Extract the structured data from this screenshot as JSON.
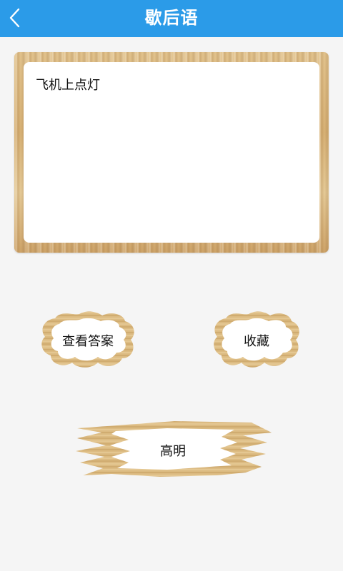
{
  "header": {
    "title": "歇后语",
    "back_icon": "chevron-left-icon"
  },
  "riddle": {
    "question": "飞机上点灯",
    "answer": "高明"
  },
  "buttons": {
    "show_answer": "查看答案",
    "favorite": "收藏"
  },
  "colors": {
    "header_bg": "#2b9be8",
    "wood": "#d9b67b"
  }
}
